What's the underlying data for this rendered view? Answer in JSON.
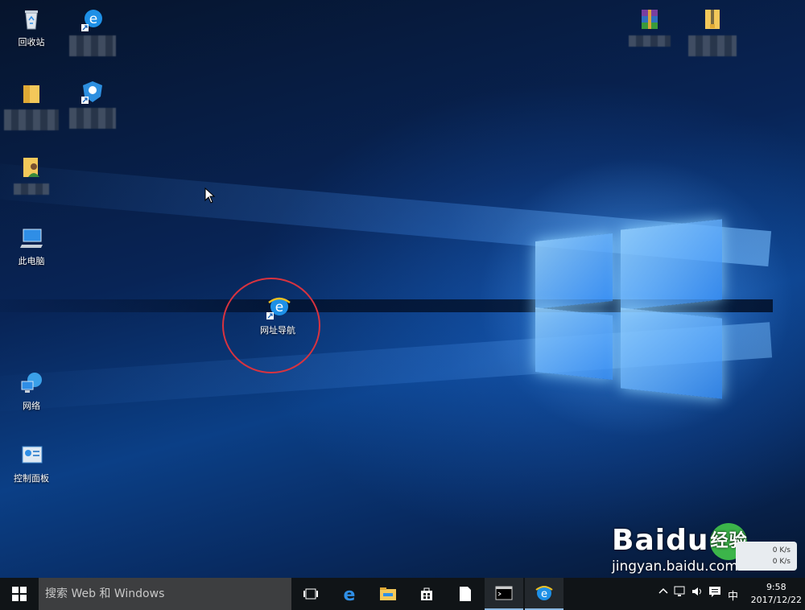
{
  "desktop": {
    "icons": [
      {
        "label": "回收站",
        "icon": "recycle-bin-icon"
      },
      {
        "label": "",
        "icon": "ie-shortcut-icon"
      },
      {
        "label": "",
        "icon": "folder-icon"
      },
      {
        "label": "",
        "icon": "security-shortcut-icon"
      },
      {
        "label": "",
        "icon": "user-folder-icon"
      },
      {
        "label": "此电脑",
        "icon": "this-pc-icon"
      },
      {
        "label": "网址导航",
        "icon": "ie-shortcut-icon"
      },
      {
        "label": "网络",
        "icon": "network-icon"
      },
      {
        "label": "控制面板",
        "icon": "control-panel-icon"
      },
      {
        "label": "",
        "icon": "winrar-icon"
      },
      {
        "label": "",
        "icon": "zip-folder-icon"
      }
    ]
  },
  "taskbar": {
    "search_placeholder": "搜索 Web 和 Windows",
    "ime": "中",
    "time": "9:58",
    "date": "2017/12/22"
  },
  "speed_widget": {
    "upload": "0 K/s",
    "download": "0 K/s"
  },
  "watermark": {
    "brand": "Baidu",
    "badge": "经验",
    "url": "jingyan.baidu.com"
  },
  "colors": {
    "accent": "#d8333f",
    "taskbar": "#101417",
    "search_box": "#3d3e40"
  }
}
